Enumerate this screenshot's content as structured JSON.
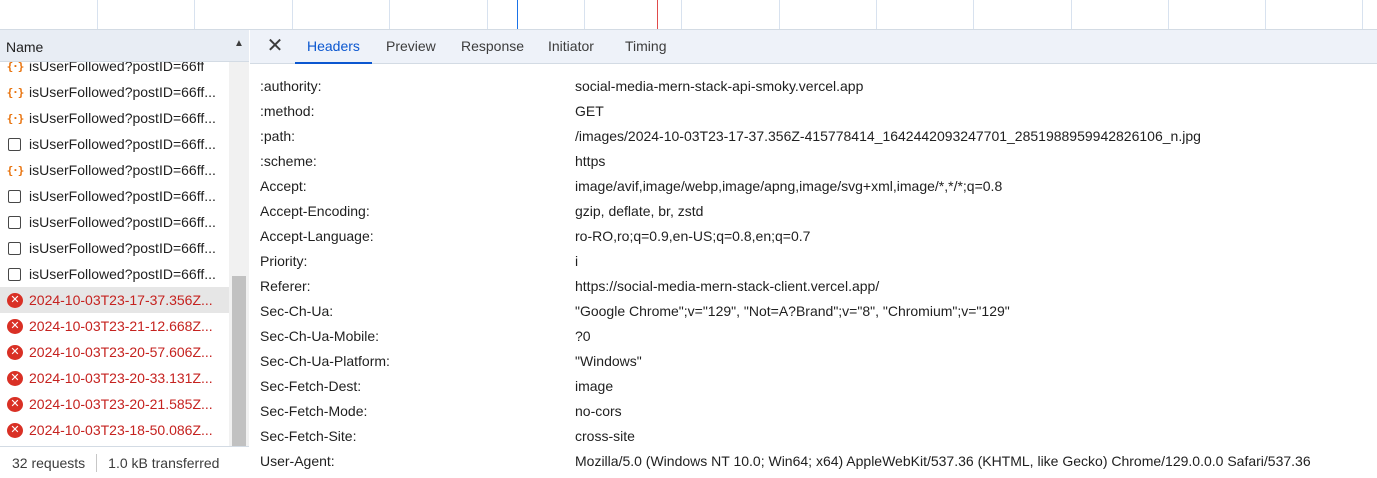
{
  "request_list": {
    "header_label": "Name",
    "rows": [
      {
        "icon": "json-icon",
        "label": "isUserFollowed?postID=66ff",
        "error": false,
        "selected": false
      },
      {
        "icon": "json-icon",
        "label": "isUserFollowed?postID=66ff...",
        "error": false,
        "selected": false
      },
      {
        "icon": "json-icon",
        "label": "isUserFollowed?postID=66ff...",
        "error": false,
        "selected": false
      },
      {
        "icon": "doc-icon",
        "label": "isUserFollowed?postID=66ff...",
        "error": false,
        "selected": false
      },
      {
        "icon": "json-icon",
        "label": "isUserFollowed?postID=66ff...",
        "error": false,
        "selected": false
      },
      {
        "icon": "doc-icon",
        "label": "isUserFollowed?postID=66ff...",
        "error": false,
        "selected": false
      },
      {
        "icon": "doc-icon",
        "label": "isUserFollowed?postID=66ff...",
        "error": false,
        "selected": false
      },
      {
        "icon": "doc-icon",
        "label": "isUserFollowed?postID=66ff...",
        "error": false,
        "selected": false
      },
      {
        "icon": "doc-icon",
        "label": "isUserFollowed?postID=66ff...",
        "error": false,
        "selected": false
      },
      {
        "icon": "error-icon",
        "label": "2024-10-03T23-17-37.356Z...",
        "error": true,
        "selected": true
      },
      {
        "icon": "error-icon",
        "label": "2024-10-03T23-21-12.668Z...",
        "error": true,
        "selected": false
      },
      {
        "icon": "error-icon",
        "label": "2024-10-03T23-20-57.606Z...",
        "error": true,
        "selected": false
      },
      {
        "icon": "error-icon",
        "label": "2024-10-03T23-20-33.131Z...",
        "error": true,
        "selected": false
      },
      {
        "icon": "error-icon",
        "label": "2024-10-03T23-20-21.585Z...",
        "error": true,
        "selected": false
      },
      {
        "icon": "error-icon",
        "label": "2024-10-03T23-18-50.086Z...",
        "error": true,
        "selected": false
      }
    ],
    "status": {
      "requests": "32 requests",
      "transferred": "1.0 kB transferred"
    }
  },
  "details": {
    "tabs": [
      {
        "label": "Headers",
        "active": true
      },
      {
        "label": "Preview",
        "active": false
      },
      {
        "label": "Response",
        "active": false
      },
      {
        "label": "Initiator",
        "active": false
      },
      {
        "label": "Timing",
        "active": false
      }
    ],
    "headers": [
      {
        "name": ":authority:",
        "value": "social-media-mern-stack-api-smoky.vercel.app"
      },
      {
        "name": ":method:",
        "value": "GET"
      },
      {
        "name": ":path:",
        "value": "/images/2024-10-03T23-17-37.356Z-415778414_1642442093247701_2851988959942826106_n.jpg"
      },
      {
        "name": ":scheme:",
        "value": "https"
      },
      {
        "name": "Accept:",
        "value": "image/avif,image/webp,image/apng,image/svg+xml,image/*,*/*;q=0.8"
      },
      {
        "name": "Accept-Encoding:",
        "value": "gzip, deflate, br, zstd"
      },
      {
        "name": "Accept-Language:",
        "value": "ro-RO,ro;q=0.9,en-US;q=0.8,en;q=0.7"
      },
      {
        "name": "Priority:",
        "value": "i"
      },
      {
        "name": "Referer:",
        "value": "https://social-media-mern-stack-client.vercel.app/"
      },
      {
        "name": "Sec-Ch-Ua:",
        "value": "\"Google Chrome\";v=\"129\", \"Not=A?Brand\";v=\"8\", \"Chromium\";v=\"129\""
      },
      {
        "name": "Sec-Ch-Ua-Mobile:",
        "value": "?0"
      },
      {
        "name": "Sec-Ch-Ua-Platform:",
        "value": "\"Windows\""
      },
      {
        "name": "Sec-Fetch-Dest:",
        "value": "image"
      },
      {
        "name": "Sec-Fetch-Mode:",
        "value": "no-cors"
      },
      {
        "name": "Sec-Fetch-Site:",
        "value": "cross-site"
      },
      {
        "name": "User-Agent:",
        "value": "Mozilla/5.0 (Windows NT 10.0; Win64; x64) AppleWebKit/537.36 (KHTML, like Gecko) Chrome/129.0.0.0 Safari/537.36"
      }
    ]
  },
  "colors": {
    "accent": "#0b57d0",
    "error": "#d93025",
    "timeline_blue": "#1a73e8",
    "timeline_red": "#e04b4b"
  },
  "icons": {
    "close": "close-icon",
    "scroll_up": "scroll-up-icon",
    "scroll_down": "scroll-down-icon"
  }
}
